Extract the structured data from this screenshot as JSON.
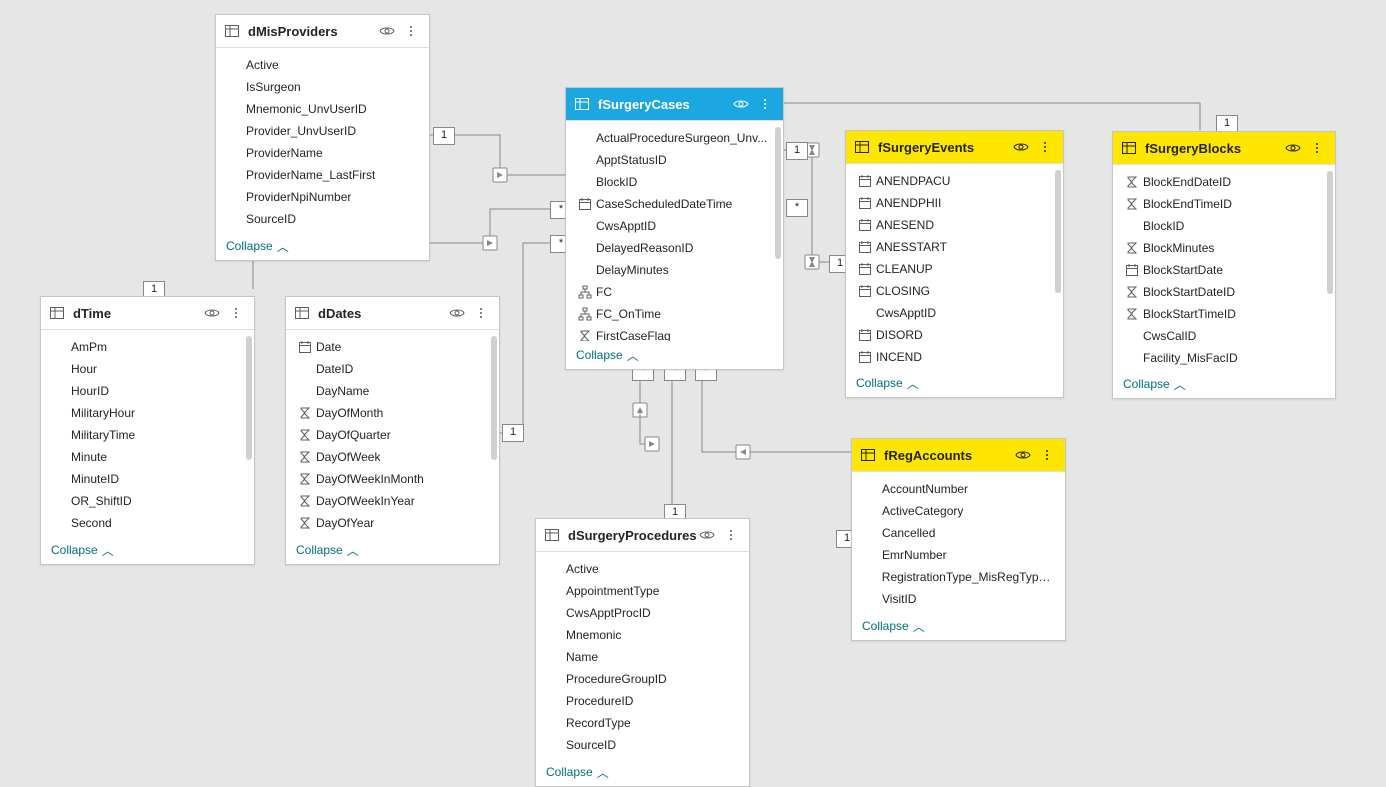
{
  "collapse_label": "Collapse",
  "tables": {
    "dMisProviders": {
      "title": "dMisProviders",
      "fields": [
        {
          "label": "Active"
        },
        {
          "label": "IsSurgeon"
        },
        {
          "label": "Mnemonic_UnvUserID"
        },
        {
          "label": "Provider_UnvUserID"
        },
        {
          "label": "ProviderName"
        },
        {
          "label": "ProviderName_LastFirst"
        },
        {
          "label": "ProviderNpiNumber"
        },
        {
          "label": "SourceID"
        }
      ]
    },
    "dTime": {
      "title": "dTime",
      "fields": [
        {
          "label": "AmPm"
        },
        {
          "label": "Hour"
        },
        {
          "label": "HourID"
        },
        {
          "label": "MilitaryHour"
        },
        {
          "label": "MilitaryTime"
        },
        {
          "label": "Minute"
        },
        {
          "label": "MinuteID"
        },
        {
          "label": "OR_ShiftID"
        },
        {
          "label": "Second"
        }
      ]
    },
    "dDates": {
      "title": "dDates",
      "fields": [
        {
          "label": "Date",
          "icon": "calendar"
        },
        {
          "label": "DateID"
        },
        {
          "label": "DayName"
        },
        {
          "label": "DayOfMonth",
          "icon": "sigma"
        },
        {
          "label": "DayOfQuarter",
          "icon": "sigma"
        },
        {
          "label": "DayOfWeek",
          "icon": "sigma"
        },
        {
          "label": "DayOfWeekInMonth",
          "icon": "sigma"
        },
        {
          "label": "DayOfWeekInYear",
          "icon": "sigma"
        },
        {
          "label": "DayOfYear",
          "icon": "sigma"
        }
      ]
    },
    "fSurgeryCases": {
      "title": "fSurgeryCases",
      "fields": [
        {
          "label": "ActualProcedureSurgeon_Unv..."
        },
        {
          "label": "ApptStatusID"
        },
        {
          "label": "BlockID"
        },
        {
          "label": "CaseScheduledDateTime",
          "icon": "calendar"
        },
        {
          "label": "CwsApptID"
        },
        {
          "label": "DelayedReasonID"
        },
        {
          "label": "DelayMinutes"
        },
        {
          "label": "FC",
          "icon": "hierarchy"
        },
        {
          "label": "FC_OnTime",
          "icon": "hierarchy"
        },
        {
          "label": "FirstCaseFlag",
          "icon": "sigma"
        }
      ]
    },
    "fSurgeryEvents": {
      "title": "fSurgeryEvents",
      "fields": [
        {
          "label": "ANENDPACU",
          "icon": "calendar"
        },
        {
          "label": "ANENDPHII",
          "icon": "calendar"
        },
        {
          "label": "ANESEND",
          "icon": "calendar"
        },
        {
          "label": "ANESSTART",
          "icon": "calendar"
        },
        {
          "label": "CLEANUP",
          "icon": "calendar"
        },
        {
          "label": "CLOSING",
          "icon": "calendar"
        },
        {
          "label": "CwsApptID"
        },
        {
          "label": "DISORD",
          "icon": "calendar"
        },
        {
          "label": "INCEND",
          "icon": "calendar"
        }
      ]
    },
    "fSurgeryBlocks": {
      "title": "fSurgeryBlocks",
      "fields": [
        {
          "label": "BlockEndDateID",
          "icon": "sigma"
        },
        {
          "label": "BlockEndTimeID",
          "icon": "sigma"
        },
        {
          "label": "BlockID"
        },
        {
          "label": "BlockMinutes",
          "icon": "sigma"
        },
        {
          "label": "BlockStartDate",
          "icon": "calendar"
        },
        {
          "label": "BlockStartDateID",
          "icon": "sigma"
        },
        {
          "label": "BlockStartTimeID",
          "icon": "sigma"
        },
        {
          "label": "CwsCalID"
        },
        {
          "label": "Facility_MisFacID"
        }
      ]
    },
    "dSurgeryProcedures": {
      "title": "dSurgeryProcedures",
      "fields": [
        {
          "label": "Active"
        },
        {
          "label": "AppointmentType"
        },
        {
          "label": "CwsApptProcID"
        },
        {
          "label": "Mnemonic"
        },
        {
          "label": "Name"
        },
        {
          "label": "ProcedureGroupID"
        },
        {
          "label": "ProcedureID"
        },
        {
          "label": "RecordType"
        },
        {
          "label": "SourceID"
        }
      ]
    },
    "fRegAccounts": {
      "title": "fRegAccounts",
      "fields": [
        {
          "label": "AccountNumber"
        },
        {
          "label": "ActiveCategory"
        },
        {
          "label": "Cancelled"
        },
        {
          "label": "EmrNumber"
        },
        {
          "label": "RegistrationType_MisRegTypeID"
        },
        {
          "label": "VisitID"
        }
      ]
    }
  },
  "cardinalities": {
    "c1": "1",
    "cm": "*"
  }
}
